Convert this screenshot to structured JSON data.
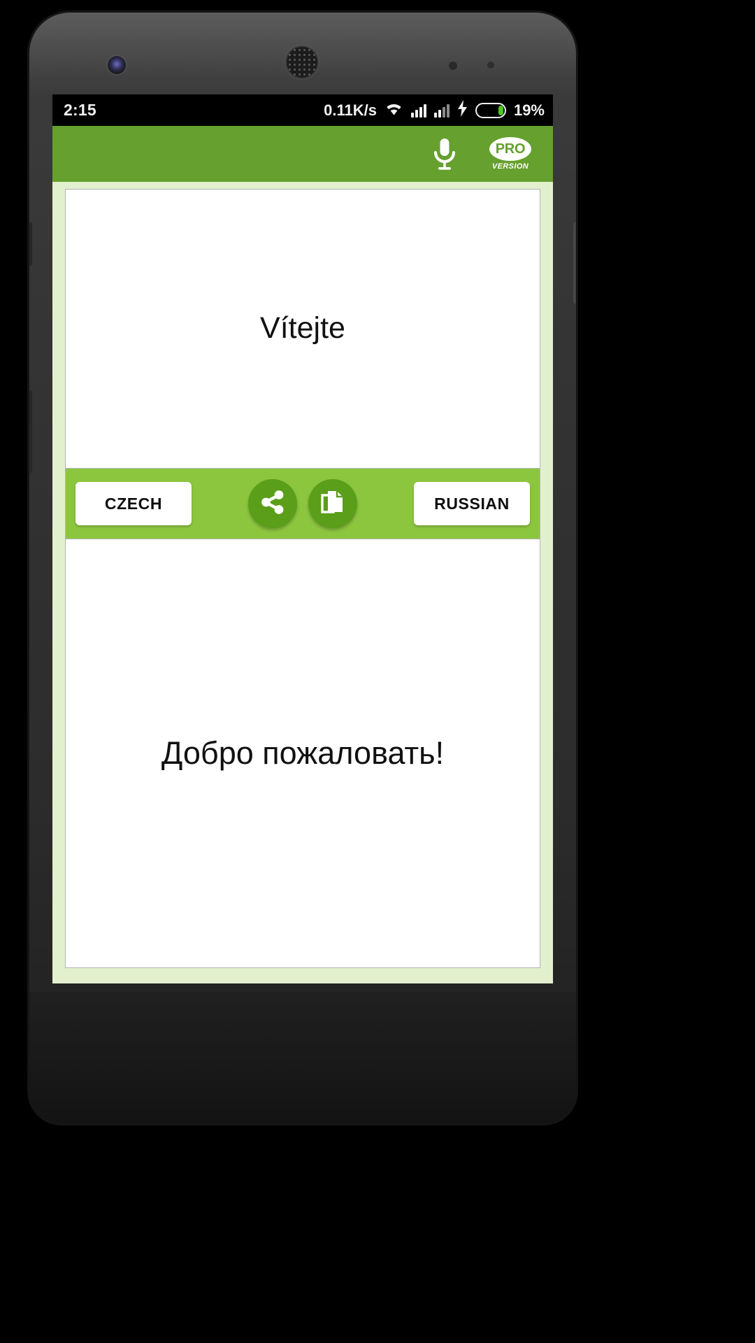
{
  "status_bar": {
    "clock": "2:15",
    "network_speed": "0.11K/s",
    "wifi_icon": "wifi-icon",
    "signal_icon_1": "signal-bars-icon",
    "signal_icon_2": "signal-bars-icon-secondary",
    "charging_icon": "charging-bolt-icon",
    "battery_percent": "19%",
    "battery_level": 19
  },
  "app_bar": {
    "mic_icon": "microphone-icon",
    "pro_badge_label": "PRO",
    "pro_version_label": "VERSION",
    "background_color": "#66A02F"
  },
  "translation": {
    "source": {
      "language": "CZECH",
      "text": "Vítejte"
    },
    "target": {
      "language": "RUSSIAN",
      "text": "Добро пожаловать!"
    }
  },
  "action_bar": {
    "background_color": "#8CC63F",
    "share_icon": "share-icon",
    "copy_icon": "copy-icon",
    "button_color": "#5A9E19"
  },
  "theme": {
    "screen_background": "#E2F0CE",
    "card_background": "#ffffff",
    "card_border": "#b5b5b5"
  }
}
